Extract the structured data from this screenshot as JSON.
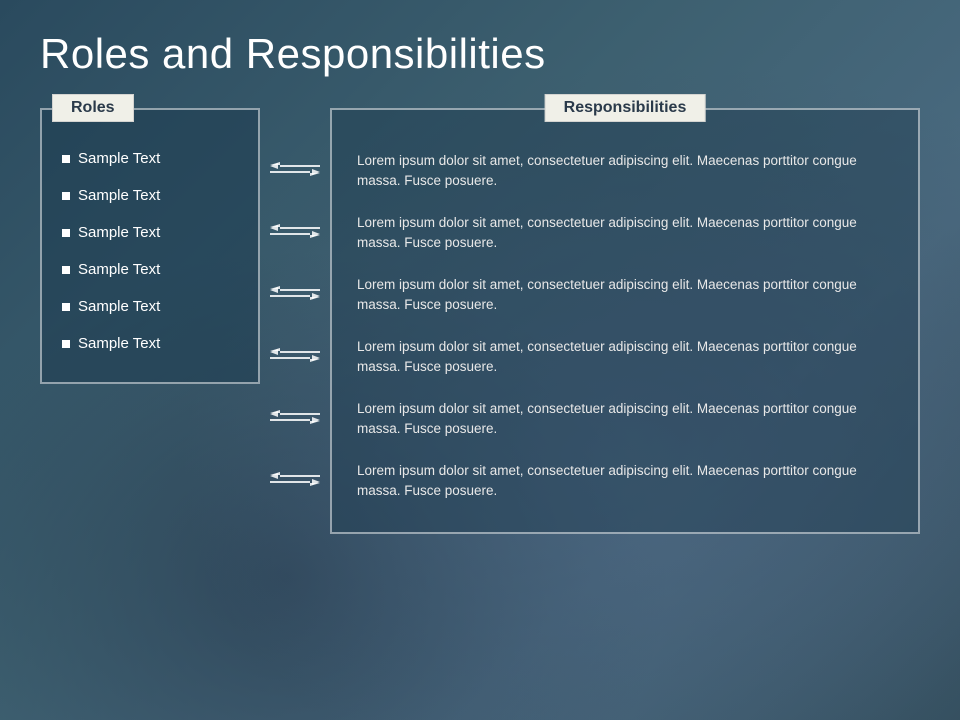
{
  "page": {
    "title": "Roles and Responsibilities",
    "roles_header": "Roles",
    "responsibilities_header": "Responsibilities"
  },
  "roles": [
    {
      "id": 1,
      "label": "Sample Text"
    },
    {
      "id": 2,
      "label": "Sample Text"
    },
    {
      "id": 3,
      "label": "Sample Text"
    },
    {
      "id": 4,
      "label": "Sample Text"
    },
    {
      "id": 5,
      "label": "Sample Text"
    },
    {
      "id": 6,
      "label": "Sample Text"
    }
  ],
  "responsibilities": [
    {
      "id": 1,
      "text": "Lorem ipsum dolor sit amet, consectetuer adipiscing elit. Maecenas porttitor congue massa. Fusce posuere."
    },
    {
      "id": 2,
      "text": "Lorem ipsum dolor sit amet, consectetuer adipiscing elit. Maecenas porttitor congue massa. Fusce posuere."
    },
    {
      "id": 3,
      "text": "Lorem ipsum dolor sit amet, consectetuer adipiscing elit. Maecenas porttitor congue massa. Fusce posuere."
    },
    {
      "id": 4,
      "text": "Lorem ipsum dolor sit amet, consectetuer adipiscing elit. Maecenas porttitor congue massa. Fusce posuere."
    },
    {
      "id": 5,
      "text": "Lorem ipsum dolor sit amet, consectetuer adipiscing elit. Maecenas porttitor congue massa. Fusce posuere."
    },
    {
      "id": 6,
      "text": "Lorem ipsum dolor sit amet, consectetuer adipiscing elit. Maecenas porttitor congue massa. Fusce posuere."
    }
  ]
}
